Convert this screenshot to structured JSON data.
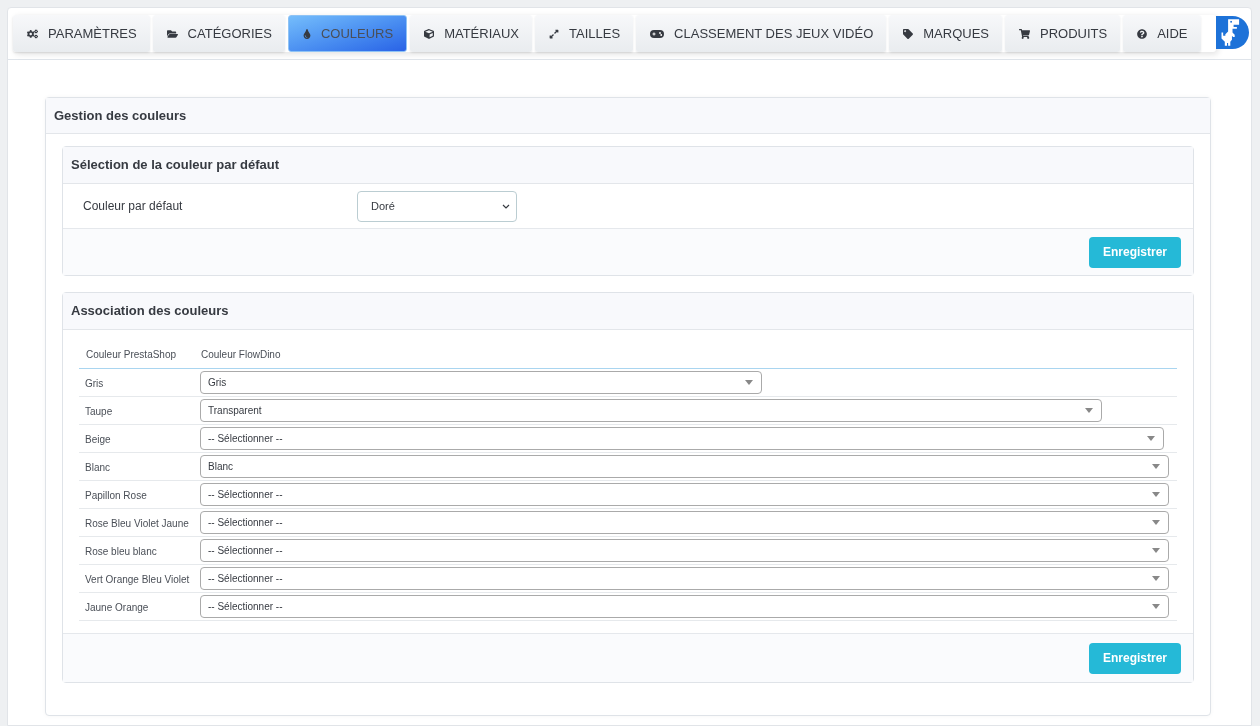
{
  "tabs": [
    {
      "label": "PARAMÈTRES",
      "selected": false
    },
    {
      "label": "CATÉGORIES",
      "selected": false
    },
    {
      "label": "COULEURS",
      "selected": true
    },
    {
      "label": "MATÉRIAUX",
      "selected": false
    },
    {
      "label": "TAILLES",
      "selected": false
    },
    {
      "label": "CLASSEMENT DES JEUX VIDÉO",
      "selected": false
    },
    {
      "label": "MARQUES",
      "selected": false
    },
    {
      "label": "PRODUITS",
      "selected": false
    },
    {
      "label": "AIDE",
      "selected": false
    }
  ],
  "panel": {
    "title": "Gestion des couleurs",
    "default_section": {
      "title": "Sélection de la couleur par défaut",
      "field_label": "Couleur par défaut",
      "field_value": "Doré",
      "save_button": "Enregistrer"
    },
    "association_section": {
      "title": "Association des couleurs",
      "columns": [
        "Couleur PrestaShop",
        "Couleur FlowDino"
      ],
      "rows": [
        {
          "prestashop": "Gris",
          "flowdino": "Gris"
        },
        {
          "prestashop": "Taupe",
          "flowdino": "Transparent"
        },
        {
          "prestashop": "Beige",
          "flowdino": "-- Sélectionner --"
        },
        {
          "prestashop": "Blanc",
          "flowdino": "Blanc"
        },
        {
          "prestashop": "Papillon Rose",
          "flowdino": "-- Sélectionner --"
        },
        {
          "prestashop": "Rose Bleu Violet Jaune",
          "flowdino": "-- Sélectionner --"
        },
        {
          "prestashop": "Rose bleu blanc",
          "flowdino": "-- Sélectionner --"
        },
        {
          "prestashop": "Vert Orange Bleu Violet",
          "flowdino": "-- Sélectionner --"
        },
        {
          "prestashop": "Jaune Orange",
          "flowdino": "-- Sélectionner --"
        }
      ],
      "save_button": "Enregistrer"
    }
  }
}
